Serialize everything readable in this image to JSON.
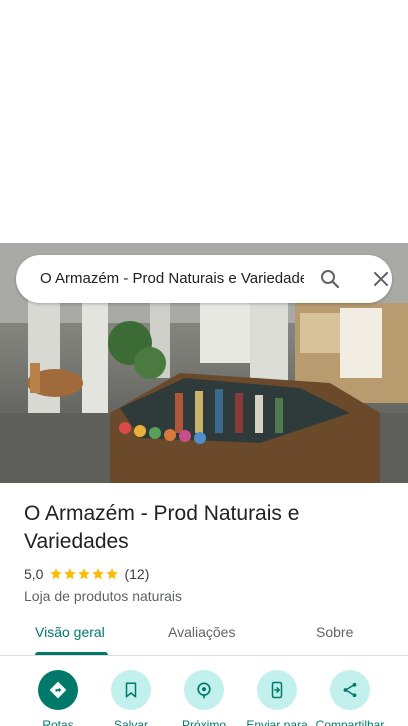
{
  "search": {
    "query": "O Armazém - Prod Naturais e Variedades"
  },
  "place": {
    "name": "O Armazém - Prod Naturais e Variedades",
    "rating": "5,0",
    "stars": 5,
    "review_count": "(12)",
    "category": "Loja de produtos naturais"
  },
  "tabs": [
    {
      "label": "Visão geral",
      "active": true
    },
    {
      "label": "Avaliações",
      "active": false
    },
    {
      "label": "Sobre",
      "active": false
    }
  ],
  "actions": [
    {
      "label": "Rotas",
      "icon": "directions-icon"
    },
    {
      "label": "Salvar",
      "icon": "bookmark-icon"
    },
    {
      "label": "Próximo",
      "icon": "nearby-icon"
    },
    {
      "label": "Enviar para",
      "icon": "send-to-phone-icon"
    },
    {
      "label": "Compartilhar",
      "icon": "share-icon"
    }
  ],
  "colors": {
    "accent": "#00796b",
    "accent_light": "#c2f0ec",
    "star": "#fbbc04"
  }
}
